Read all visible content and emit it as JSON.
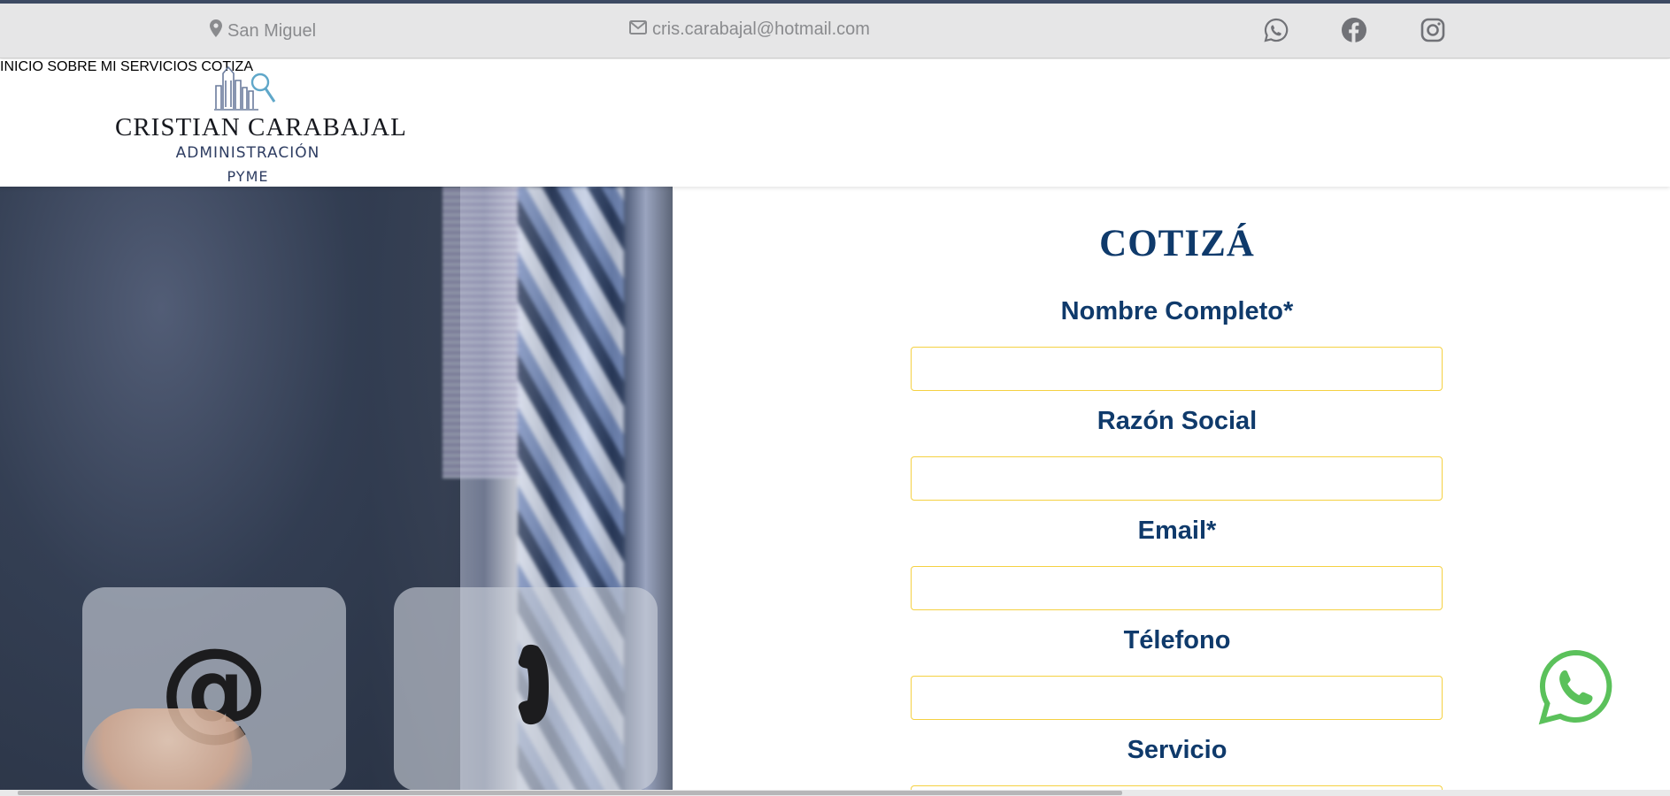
{
  "colors": {
    "accent_line": "#3d4a63",
    "topbar_bg": "#e6e6e7",
    "topbar_text": "#8a8b8e",
    "nav_text": "#0f3a6b",
    "form_heading": "#0f3a6b",
    "input_border": "#f5d142",
    "whatsapp_green": "#5bc15b"
  },
  "topbar": {
    "location": {
      "icon": "map-pin-icon",
      "text": "San Miguel"
    },
    "email": {
      "icon": "envelope-icon",
      "text": "cris.carabajal@hotmail.com"
    },
    "social": [
      {
        "icon": "whatsapp-icon"
      },
      {
        "icon": "facebook-icon"
      },
      {
        "icon": "instagram-icon"
      }
    ]
  },
  "header": {
    "logo": {
      "brand": "CRISTIAN CARABAJAL",
      "line1": "ADMINISTRACIÓN",
      "line2": "PYME",
      "mark_icon": "buildings-magnifier-icon"
    },
    "nav": [
      {
        "label": "INICIO"
      },
      {
        "label": "SOBRE MI"
      },
      {
        "label": "SERVICIOS"
      },
      {
        "label": "COTIZA"
      }
    ]
  },
  "hero": {
    "tiles": [
      {
        "icon": "at-sign-icon",
        "glyph": "@"
      },
      {
        "icon": "phone-handset-icon",
        "glyph": ")"
      }
    ]
  },
  "form": {
    "title": "COTIZÁ",
    "fields": [
      {
        "label": "Nombre Completo*",
        "value": "",
        "placeholder": ""
      },
      {
        "label": "Razón Social",
        "value": "",
        "placeholder": ""
      },
      {
        "label": "Email*",
        "value": "",
        "placeholder": ""
      },
      {
        "label": "Télefono",
        "value": "",
        "placeholder": ""
      },
      {
        "label": "Servicio",
        "value": "",
        "placeholder": ""
      }
    ]
  },
  "floating": {
    "icon": "whatsapp-icon"
  }
}
